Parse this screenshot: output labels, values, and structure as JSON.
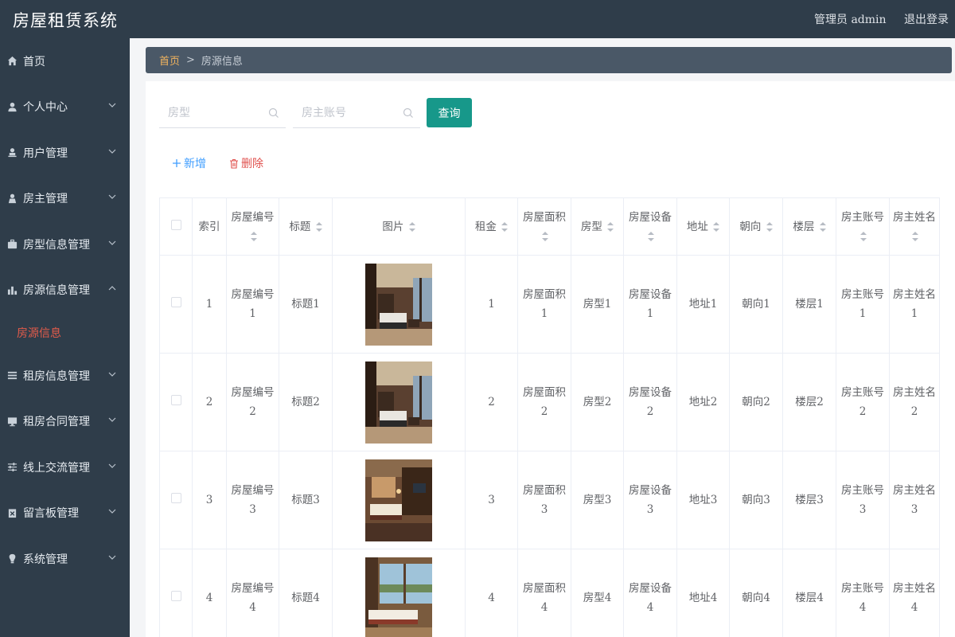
{
  "app": {
    "title": "房屋租赁系统"
  },
  "header": {
    "user": "管理员 admin",
    "logout": "退出登录"
  },
  "sidebar": {
    "items": [
      {
        "label": "首页",
        "icon": "home-icon",
        "expandable": false
      },
      {
        "label": "个人中心",
        "icon": "user-icon",
        "expandable": true
      },
      {
        "label": "用户管理",
        "icon": "user-manage-icon",
        "expandable": true
      },
      {
        "label": "房主管理",
        "icon": "person-icon",
        "expandable": true
      },
      {
        "label": "房型信息管理",
        "icon": "briefcase-icon",
        "expandable": true
      },
      {
        "label": "房源信息管理",
        "icon": "bar-chart-icon",
        "expandable": true,
        "expanded": true,
        "children": [
          "房源信息"
        ]
      },
      {
        "label": "租房信息管理",
        "icon": "list-icon",
        "expandable": true
      },
      {
        "label": "租房合同管理",
        "icon": "monitor-icon",
        "expandable": true
      },
      {
        "label": "线上交流管理",
        "icon": "sliders-icon",
        "expandable": true
      },
      {
        "label": "留言板管理",
        "icon": "clipboard-icon",
        "expandable": true
      },
      {
        "label": "系统管理",
        "icon": "bulb-icon",
        "expandable": true
      }
    ],
    "active_child": "房源信息"
  },
  "breadcrumb": {
    "home": "首页",
    "separator": ">",
    "current": "房源信息"
  },
  "search": {
    "room_type_placeholder": "房型",
    "owner_account_placeholder": "房主账号",
    "query_label": "查询"
  },
  "actions": {
    "add_label": "新增",
    "delete_label": "删除"
  },
  "table": {
    "columns": [
      "索引",
      "房屋编号",
      "标题",
      "图片",
      "租金",
      "房屋面积",
      "房型",
      "房屋设备",
      "地址",
      "朝向",
      "楼层",
      "房主账号",
      "房主姓名"
    ],
    "rows": [
      {
        "index": "1",
        "house_no": "房屋编号1",
        "title": "标题1",
        "rent": "1",
        "area": "房屋面积1",
        "room_type": "房型1",
        "equipment": "房屋设备1",
        "address": "地址1",
        "orientation": "朝向1",
        "floor": "楼层1",
        "owner_account": "房主账号1",
        "owner_name": "房主姓名1"
      },
      {
        "index": "2",
        "house_no": "房屋编号2",
        "title": "标题2",
        "rent": "2",
        "area": "房屋面积2",
        "room_type": "房型2",
        "equipment": "房屋设备2",
        "address": "地址2",
        "orientation": "朝向2",
        "floor": "楼层2",
        "owner_account": "房主账号2",
        "owner_name": "房主姓名2"
      },
      {
        "index": "3",
        "house_no": "房屋编号3",
        "title": "标题3",
        "rent": "3",
        "area": "房屋面积3",
        "room_type": "房型3",
        "equipment": "房屋设备3",
        "address": "地址3",
        "orientation": "朝向3",
        "floor": "楼层3",
        "owner_account": "房主账号3",
        "owner_name": "房主姓名3"
      },
      {
        "index": "4",
        "house_no": "房屋编号4",
        "title": "标题4",
        "rent": "4",
        "area": "房屋面积4",
        "room_type": "房型4",
        "equipment": "房屋设备4",
        "address": "地址4",
        "orientation": "朝向4",
        "floor": "楼层4",
        "owner_account": "房主账号4",
        "owner_name": "房主姓名4"
      }
    ]
  },
  "colors": {
    "sidebar_bg": "#2f3d4a",
    "accent": "#17988a",
    "active_menu": "#e35b4a",
    "add": "#409eff",
    "delete": "#e0524f"
  }
}
